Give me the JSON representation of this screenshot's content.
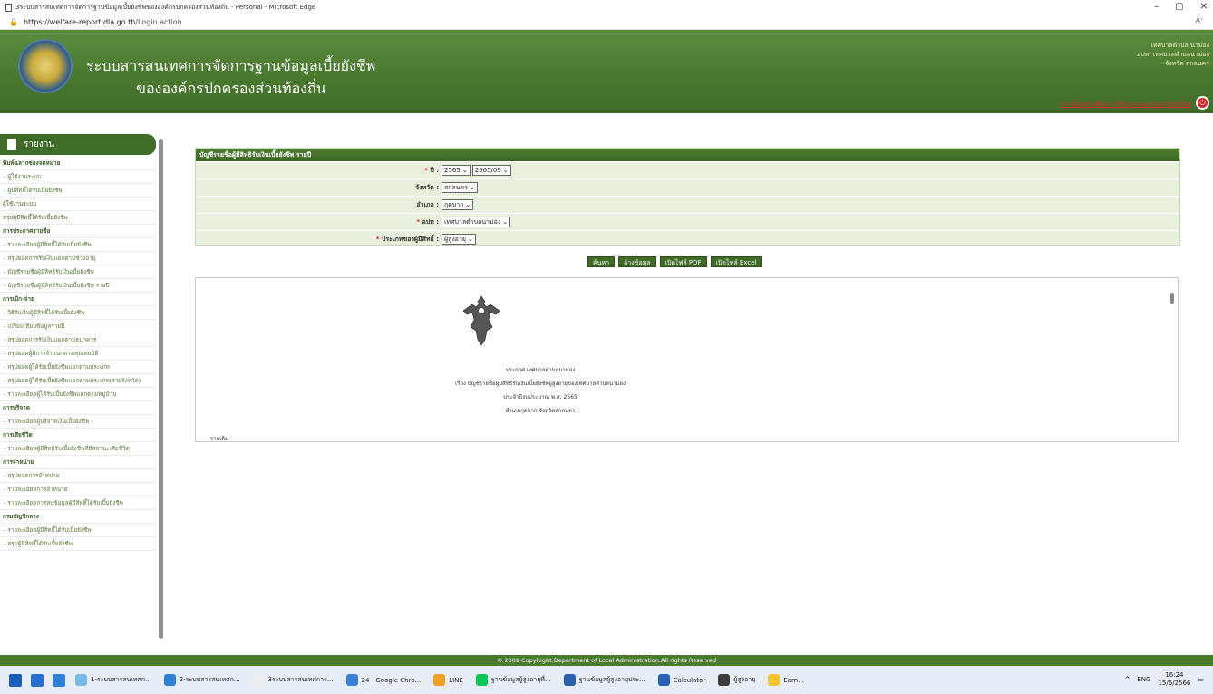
{
  "window": {
    "title": "3ระบบสารสนเทศการจัดการฐานข้อมูลเบี้ยยังชีพขององค์กรปกครองส่วนท้องถิ่น - Personal - Microsoft Edge",
    "controls": [
      "–",
      "▢",
      "✕"
    ]
  },
  "browser": {
    "url_host": "https://welfare-report.dla.go.th",
    "url_path": "/Login.action",
    "read_aloud": "A⁾"
  },
  "header": {
    "title_line1": "ระบบสารสนเทศการจัดการฐานข้อมูลเบี้ยยังชีพ",
    "title_line2": "ขององค์กรปกครองส่วนท้องถิ่น",
    "org_line1": "เทศบาลตำบล นาม่อง",
    "org_line2": "อปท. เทศบาลตำบลนาม่อง",
    "org_line3": "จังหวัด สกลนคร",
    "download_link": "ดาวน์โหลด คู่มือการใช้งานระบบ (ออนไลน์)ใหม่",
    "logout_icon": "power-icon"
  },
  "sidebar": {
    "heading": "รายงาน",
    "items": [
      {
        "label": "พิมพ์ฉลากซองจดหมาย",
        "type": "sec"
      },
      {
        "label": "- ผู้ใช้งานระบบ",
        "type": "sub"
      },
      {
        "label": "- ผู้มีสิทธิ์ได้รับเบี้ยยังชีพ",
        "type": "sub"
      },
      {
        "label": "ผู้ใช้งานระบบ",
        "type": "plain"
      },
      {
        "label": "สรุปผู้มีสิทธิ์ได้รับเบี้ยยังชีพ",
        "type": "plain"
      },
      {
        "label": "การประกาศรายชื่อ",
        "type": "sec"
      },
      {
        "label": "- รายละเอียดผู้มีสิทธิ์ได้รับเบี้ยยังชีพ",
        "type": "sub"
      },
      {
        "label": "- สรุปยอดการรับเงินแยกตามช่วงอายุ",
        "type": "sub"
      },
      {
        "label": "- บัญชีรายชื่อผู้มีสิทธิรับเงินเบี้ยยังชีพ",
        "type": "sub"
      },
      {
        "label": "- บัญชีรายชื่อผู้มีสิทธิรับเงินเบี้ยยังชีพ รายปี",
        "type": "sub"
      },
      {
        "label": "การเบิก-จ่าย",
        "type": "sec"
      },
      {
        "label": "- วิธีรับเงินผู้มีสิทธิ์ได้รับเบี้ยยังชีพ",
        "type": "sub"
      },
      {
        "label": "- เปรียบเทียบข้อมูลรายปี",
        "type": "sub"
      },
      {
        "label": "- สรุปยอดการรับเงินแยกตามธนาคาร",
        "type": "sub"
      },
      {
        "label": "- สรุปยอดผู้พิการจำแนกตามคุณสมบัติ",
        "type": "sub"
      },
      {
        "label": "- สรุปยอดผู้ได้รับเบี้ยยังชีพแยกตามประเภท",
        "type": "sub"
      },
      {
        "label": "- สรุปยอดผู้ได้รับเบี้ยยังชีพแยกตามประเภท(รายจังหวัด)",
        "type": "sub"
      },
      {
        "label": "- รายละเอียดผู้ได้รับเบี้ยยังชีพแยกตามหมู่บ้าน",
        "type": "sub"
      },
      {
        "label": "การบริจาค",
        "type": "sec"
      },
      {
        "label": "- รายละเอียดผู้บริจาคเงินเบี้ยยังชีพ",
        "type": "sub"
      },
      {
        "label": "การเสียชีวิต",
        "type": "sec"
      },
      {
        "label": "- รายละเอียดผู้มีสิทธิรับเบี้ยยังชีพที่มีสถานะเสียชีวิต",
        "type": "sub"
      },
      {
        "label": "การจำหน่าย",
        "type": "sec"
      },
      {
        "label": "- สรุปยอดการจำหน่าย",
        "type": "sub"
      },
      {
        "label": "- รายละเอียดการจำหน่าย",
        "type": "sub"
      },
      {
        "label": "- รายละเอียดการลบข้อมูลผู้มีสิทธิ์ได้รับเบี้ยยังชีพ",
        "type": "sub"
      },
      {
        "label": "กรมบัญชีกลาง",
        "type": "sec"
      },
      {
        "label": "- รายละเอียดผู้มีสิทธิ์ได้รับเบี้ยยังชีพ",
        "type": "sub"
      },
      {
        "label": "- สรุปผู้มีสิทธิ์ได้รับเบี้ยยังชีพ",
        "type": "sub"
      }
    ]
  },
  "form": {
    "title": "บัญชีรายชื่อผู้มีสิทธิรับเงินเบี้ยยังชีพ รายปี",
    "rows": [
      {
        "label": "ปี :",
        "required": true,
        "values": [
          "2565",
          "2565/09"
        ]
      },
      {
        "label": "จังหวัด :",
        "required": false,
        "values": [
          "สกลนคร"
        ]
      },
      {
        "label": "อำเภอ :",
        "required": false,
        "values": [
          "กุดบาก"
        ]
      },
      {
        "label": "อปท :",
        "required": true,
        "values": [
          "เทศบาลตำบลนาม่อง"
        ]
      },
      {
        "label": "ประเภทของผู้มีสิทธิ์ :",
        "required": true,
        "values": [
          "ผู้สูงอายุ"
        ]
      }
    ],
    "buttons": [
      "ค้นหา",
      "ล้างข้อมูล",
      "เปิดไฟล์ PDF",
      "เปิดไฟล์ Excel"
    ]
  },
  "preview": {
    "line1": "ประกาศ เทศบาลตำบลนาม่อง",
    "line2": "เรื่อง  บัญชีรายชื่อผู้มีสิทธิรับเงินเบี้ยยังชีพผู้สูงอายุของเทศบาลตำบลนาม่อง",
    "line3": "ประจำปีงบประมาณ พ.ศ. 2565",
    "line4": "อำเภอกุดบาก  จังหวัดสกลนคร",
    "more": "รายเดิม"
  },
  "footer": {
    "text": "© 2009 CopyRight.Department of Local Administration.All rights Reserved"
  },
  "taskbar": {
    "items": [
      "1-ระบบสารสนเทศก...",
      "2-ระบบสารสนเทศก...",
      "3ระบบสารสนเทศการ...",
      "24 - Google Chro...",
      "LINE",
      "ฐานข้อมูลผู้สูงอายุที่...",
      "ฐานข้อมูลผู้สูงอายุประ...",
      "Calculator",
      "ผู้สูงอายุ",
      "Earn..."
    ],
    "lang": "ENG",
    "time": "16:24",
    "date": "15/6/2566"
  }
}
